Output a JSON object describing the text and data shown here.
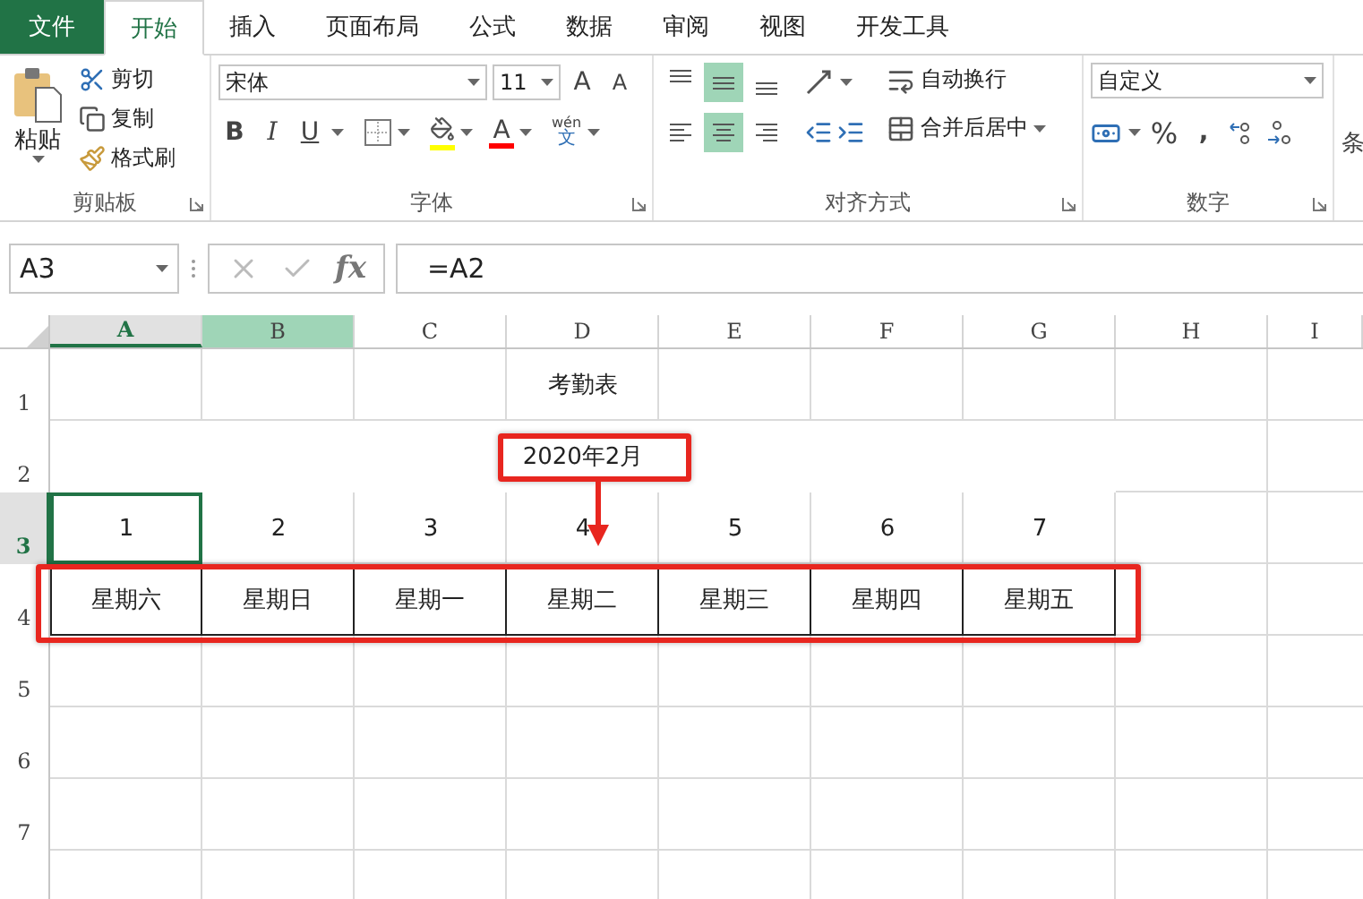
{
  "tabs": [
    {
      "label": "文件",
      "kind": "file",
      "selected": false
    },
    {
      "label": "开始",
      "kind": "tab",
      "selected": true
    },
    {
      "label": "插入",
      "kind": "tab",
      "selected": false
    },
    {
      "label": "页面布局",
      "kind": "tab",
      "selected": false
    },
    {
      "label": "公式",
      "kind": "tab",
      "selected": false
    },
    {
      "label": "数据",
      "kind": "tab",
      "selected": false
    },
    {
      "label": "审阅",
      "kind": "tab",
      "selected": false
    },
    {
      "label": "视图",
      "kind": "tab",
      "selected": false
    },
    {
      "label": "开发工具",
      "kind": "tab",
      "selected": false
    }
  ],
  "clipboard": {
    "title": "剪贴板",
    "paste": "粘贴",
    "cut": "剪切",
    "copy": "复制",
    "format_painter": "格式刷"
  },
  "font": {
    "title": "字体",
    "name": "宋体",
    "size": "11",
    "grow": "A",
    "shrink": "A",
    "bold": "B",
    "italic": "I",
    "underline": "U",
    "font_color": "A",
    "phonetic_top": "wén",
    "phonetic_bottom": "文"
  },
  "alignment": {
    "title": "对齐方式",
    "vertical": [
      {
        "kind": "top",
        "selected": false
      },
      {
        "kind": "middle",
        "selected": true
      },
      {
        "kind": "bottom",
        "selected": false
      }
    ],
    "horizontal": [
      {
        "kind": "left",
        "selected": false
      },
      {
        "kind": "center",
        "selected": true
      },
      {
        "kind": "right",
        "selected": false
      }
    ],
    "wrap": "自动换行",
    "merge": "合并后居中"
  },
  "number": {
    "title": "数字",
    "format": "自定义",
    "percent": "%",
    "comma": ","
  },
  "next_group": "条",
  "formula_bar": {
    "name_box": "A3",
    "fx": "fx",
    "formula": "=A2"
  },
  "sheet": {
    "columns": [
      {
        "label": "A",
        "selected": true,
        "highlighted": false
      },
      {
        "label": "B",
        "selected": false,
        "highlighted": true
      },
      {
        "label": "C",
        "selected": false,
        "highlighted": false
      },
      {
        "label": "D",
        "selected": false,
        "highlighted": false
      },
      {
        "label": "E",
        "selected": false,
        "highlighted": false
      },
      {
        "label": "F",
        "selected": false,
        "highlighted": false
      },
      {
        "label": "G",
        "selected": false,
        "highlighted": false
      },
      {
        "label": "H",
        "selected": false,
        "highlighted": false
      },
      {
        "label": "I",
        "selected": false,
        "highlighted": false
      }
    ],
    "rows": [
      {
        "header": "1",
        "selected": false
      },
      {
        "header": "2",
        "selected": false
      },
      {
        "header": "3",
        "selected": true
      },
      {
        "header": "4",
        "selected": false
      },
      {
        "header": "5",
        "selected": false
      },
      {
        "header": "6",
        "selected": false
      },
      {
        "header": "7",
        "selected": false
      }
    ],
    "title": "考勤表",
    "month": "2020年2月",
    "day_numbers": [
      "1",
      "2",
      "3",
      "4",
      "5",
      "6",
      "7"
    ],
    "weekdays": [
      "星期六",
      "星期日",
      "星期一",
      "星期二",
      "星期三",
      "星期四",
      "星期五"
    ]
  }
}
